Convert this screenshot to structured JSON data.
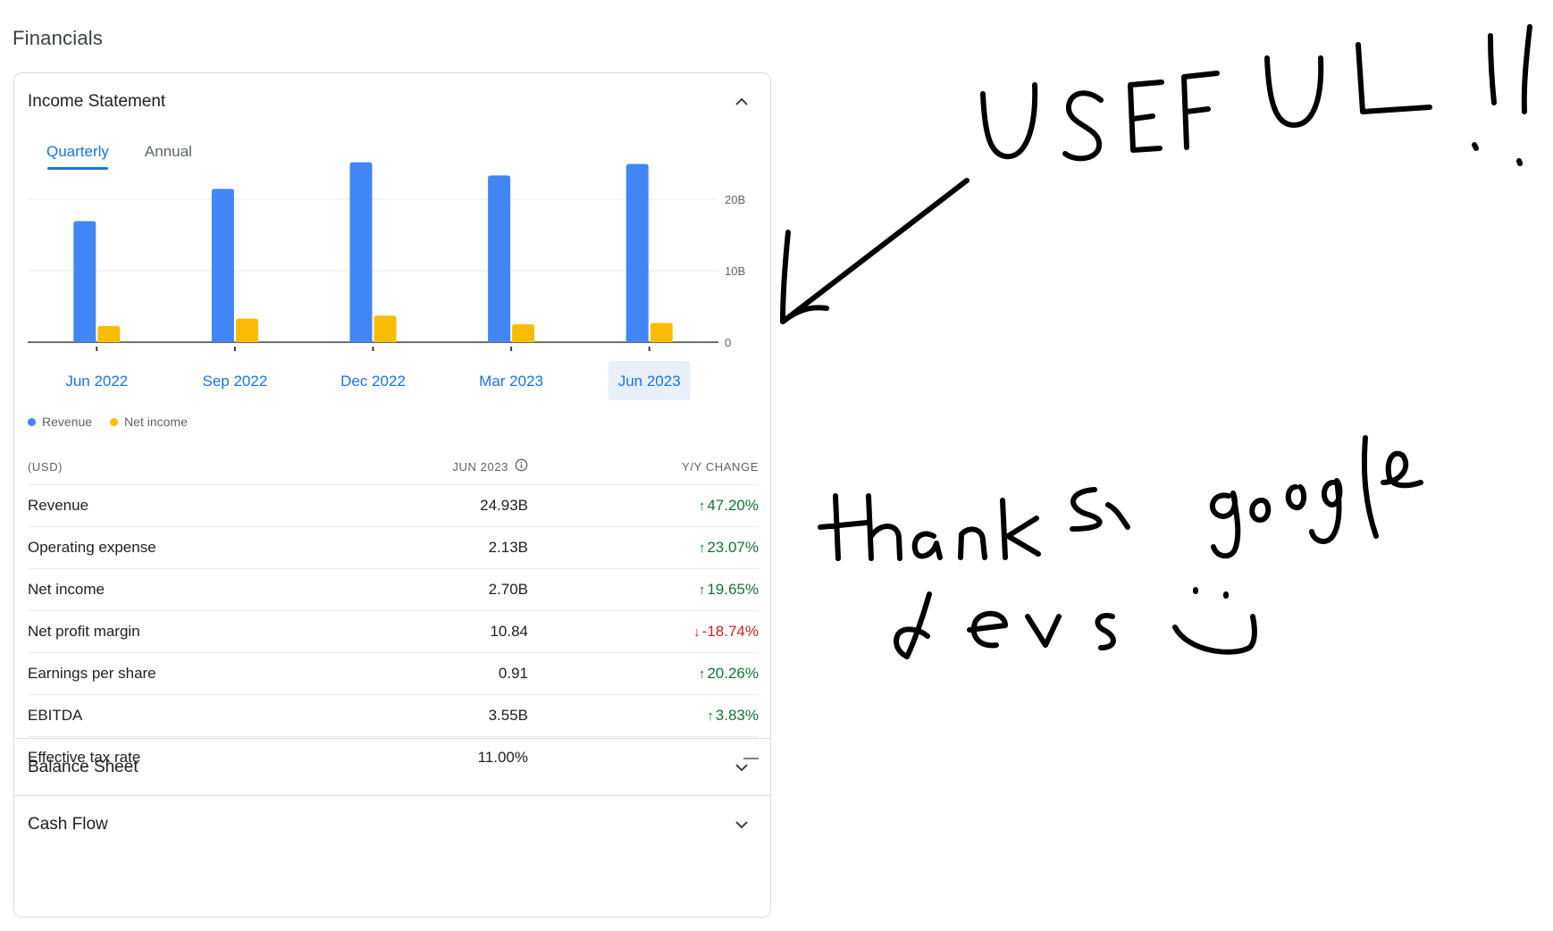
{
  "page_title": "Financials",
  "income_statement": {
    "title": "Income Statement",
    "tabs": [
      {
        "label": "Quarterly",
        "active": true
      },
      {
        "label": "Annual",
        "active": false
      }
    ],
    "legend": [
      {
        "label": "Revenue",
        "color": "#4285f4"
      },
      {
        "label": "Net income",
        "color": "#fbbc04"
      }
    ],
    "table": {
      "currency_header": "(USD)",
      "period_header": "JUN 2023",
      "change_header": "Y/Y CHANGE",
      "rows": [
        {
          "label": "Revenue",
          "value": "24.93B",
          "arrow": "↑",
          "change": "47.20%",
          "direction": "up"
        },
        {
          "label": "Operating expense",
          "value": "2.13B",
          "arrow": "↑",
          "change": "23.07%",
          "direction": "up"
        },
        {
          "label": "Net income",
          "value": "2.70B",
          "arrow": "↑",
          "change": "19.65%",
          "direction": "up"
        },
        {
          "label": "Net profit margin",
          "value": "10.84",
          "arrow": "↓",
          "change": "-18.74%",
          "direction": "down"
        },
        {
          "label": "Earnings per share",
          "value": "0.91",
          "arrow": "↑",
          "change": "20.26%",
          "direction": "up"
        },
        {
          "label": "EBITDA",
          "value": "3.55B",
          "arrow": "↑",
          "change": "3.83%",
          "direction": "up"
        },
        {
          "label": "Effective tax rate",
          "value": "11.00%",
          "arrow": "",
          "change": "—",
          "direction": "flat"
        }
      ]
    }
  },
  "balance_sheet": {
    "title": "Balance Sheet"
  },
  "cash_flow": {
    "title": "Cash Flow"
  },
  "chart_data": {
    "type": "bar",
    "categories": [
      "Jun 2022",
      "Sep 2022",
      "Dec 2022",
      "Mar 2023",
      "Jun 2023"
    ],
    "selected_category": "Jun 2023",
    "series": [
      {
        "name": "Revenue",
        "color": "#4285f4",
        "values": [
          16.93,
          21.45,
          25.17,
          23.33,
          24.93
        ]
      },
      {
        "name": "Net income",
        "color": "#fbbc04",
        "values": [
          2.26,
          3.29,
          3.72,
          2.51,
          2.7
        ]
      }
    ],
    "y_ticks": [
      {
        "value": 0,
        "label": "0"
      },
      {
        "value": 10,
        "label": "10B"
      },
      {
        "value": 20,
        "label": "20B"
      }
    ],
    "ylim": [
      0,
      26
    ],
    "grid": true,
    "legend_position": "bottom-left"
  },
  "annotations": {
    "color": "#000000",
    "lines": [
      "USEFUL!!",
      "thanks google",
      "devs"
    ],
    "smiley": "smiley-face"
  }
}
